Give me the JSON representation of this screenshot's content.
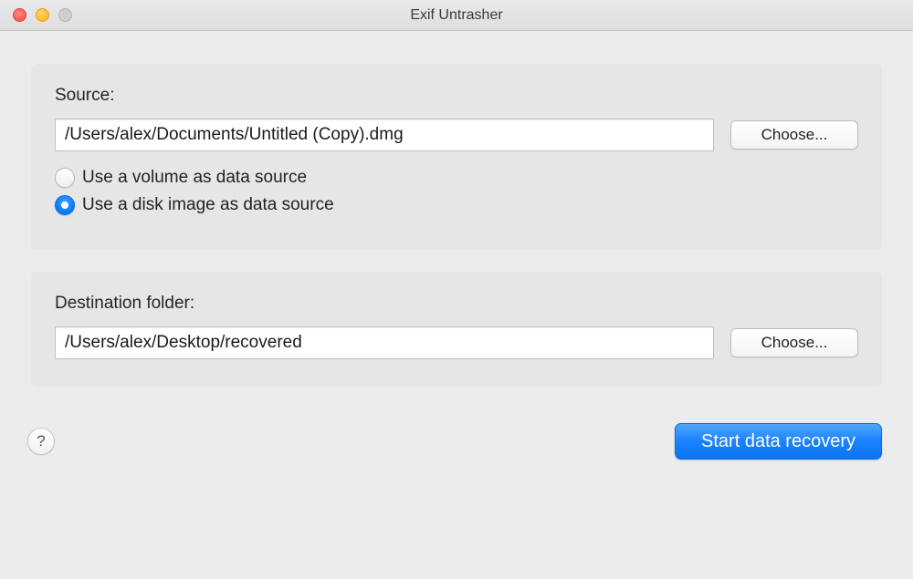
{
  "window": {
    "title": "Exif Untrasher"
  },
  "source": {
    "label": "Source:",
    "path": "/Users/alex/Documents/Untitled (Copy).dmg",
    "choose_label": "Choose...",
    "radio_volume_label": "Use a volume as data source",
    "radio_diskimage_label": "Use a disk image as data source",
    "selected": "diskimage"
  },
  "destination": {
    "label": "Destination folder:",
    "path": "/Users/alex/Desktop/recovered",
    "choose_label": "Choose..."
  },
  "footer": {
    "help_label": "?",
    "start_label": "Start data recovery"
  }
}
